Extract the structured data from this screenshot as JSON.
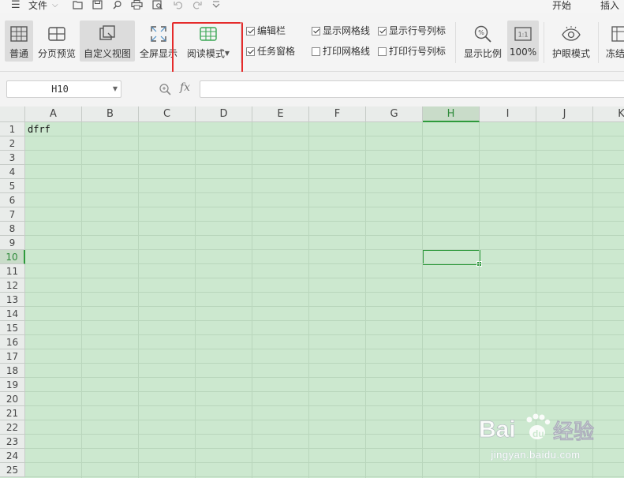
{
  "topbar": {
    "menu_icon": "hamburger-menu-icon",
    "file_label": "文件",
    "quick_access_icons": [
      "folder-open-icon",
      "save-icon",
      "find-icon",
      "print-icon",
      "print-preview-icon",
      "undo-icon",
      "redo-icon",
      "customize-icon"
    ],
    "tabs": [
      "开始",
      "插入"
    ]
  },
  "ribbon": {
    "buttons": {
      "normal": "普通",
      "page_break": "分页预览",
      "custom_view": "自定义视图",
      "full_screen": "全屏显示",
      "reading_mode": "阅读模式",
      "zoom_ratio": "显示比例",
      "zoom_100": "100%",
      "eye_protect": "护眼模式",
      "freeze": "冻结"
    },
    "checkboxes": {
      "formula_bar": {
        "label": "编辑栏",
        "checked": true
      },
      "task_pane": {
        "label": "任务窗格",
        "checked": true
      },
      "show_gridlines": {
        "label": "显示网格线",
        "checked": true
      },
      "print_gridlines": {
        "label": "打印网格线",
        "checked": false
      },
      "show_headers": {
        "label": "显示行号列标",
        "checked": true
      },
      "print_headers": {
        "label": "打印行号列标",
        "checked": false
      }
    },
    "zoom_icon_text": "1:1"
  },
  "formula_bar": {
    "name_box": "H10",
    "fx_label": "fx",
    "formula_value": ""
  },
  "sheet": {
    "columns": [
      "A",
      "B",
      "C",
      "D",
      "E",
      "F",
      "G",
      "H",
      "I",
      "J",
      "K"
    ],
    "rows": [
      "1",
      "2",
      "3",
      "4",
      "5",
      "6",
      "7",
      "8",
      "9",
      "10",
      "11",
      "12",
      "13",
      "14",
      "15",
      "16",
      "17",
      "18",
      "19",
      "20",
      "21",
      "22",
      "23",
      "24",
      "25"
    ],
    "selected_column": "H",
    "selected_row": "10",
    "cells": {
      "A1": "dfrf"
    },
    "background_color": "#cce8cf",
    "selection_color": "#2e9a3c",
    "highlight_color": "#e52b2b"
  },
  "watermark": {
    "logo": "Baidu经验",
    "url": "jingyan.baidu.com"
  }
}
